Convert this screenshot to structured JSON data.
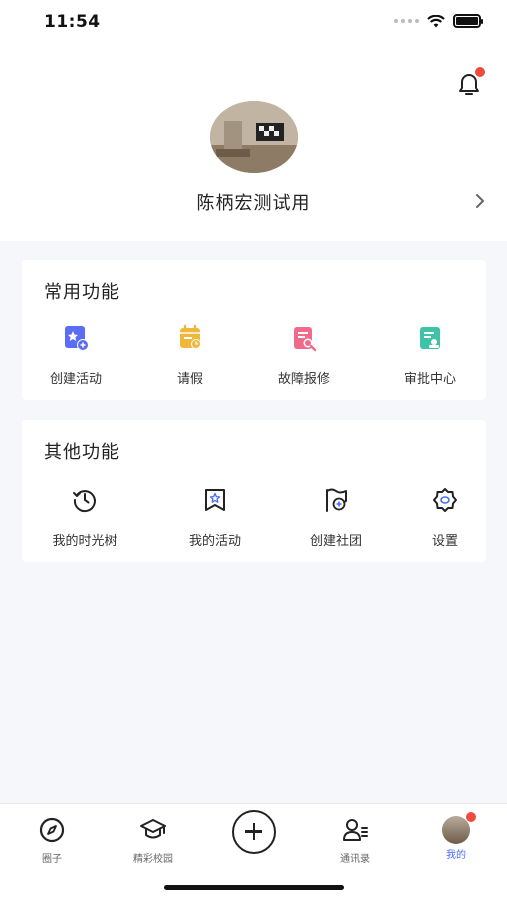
{
  "status_bar": {
    "time": "11:54"
  },
  "profile": {
    "name": "陈柄宏测试用"
  },
  "common_functions": {
    "title": "常用功能",
    "items": [
      {
        "label": "创建活动",
        "icon": "create-activity-icon",
        "color": "#5b6cf5"
      },
      {
        "label": "请假",
        "icon": "leave-request-icon",
        "color": "#f0b73d"
      },
      {
        "label": "故障报修",
        "icon": "repair-report-icon",
        "color": "#f06a8a"
      },
      {
        "label": "审批中心",
        "icon": "approval-center-icon",
        "color": "#3fc3a8"
      }
    ]
  },
  "other_functions": {
    "title": "其他功能",
    "items": [
      {
        "label": "我的时光树",
        "icon": "time-tree-icon"
      },
      {
        "label": "我的活动",
        "icon": "my-activity-icon"
      },
      {
        "label": "创建社团",
        "icon": "create-club-icon"
      },
      {
        "label": "设置",
        "icon": "settings-icon"
      }
    ]
  },
  "tabbar": {
    "tabs": [
      {
        "label": "圈子",
        "icon": "compass-icon"
      },
      {
        "label": "精彩校园",
        "icon": "graduation-cap-icon"
      },
      {
        "label": "",
        "icon": "plus-circle-icon"
      },
      {
        "label": "通讯录",
        "icon": "contacts-icon"
      },
      {
        "label": "我的",
        "icon": "avatar-icon",
        "active": true
      }
    ]
  },
  "colors": {
    "accent": "#4a6cf7",
    "badge": "#f04b40",
    "background": "#f6f7fa"
  }
}
